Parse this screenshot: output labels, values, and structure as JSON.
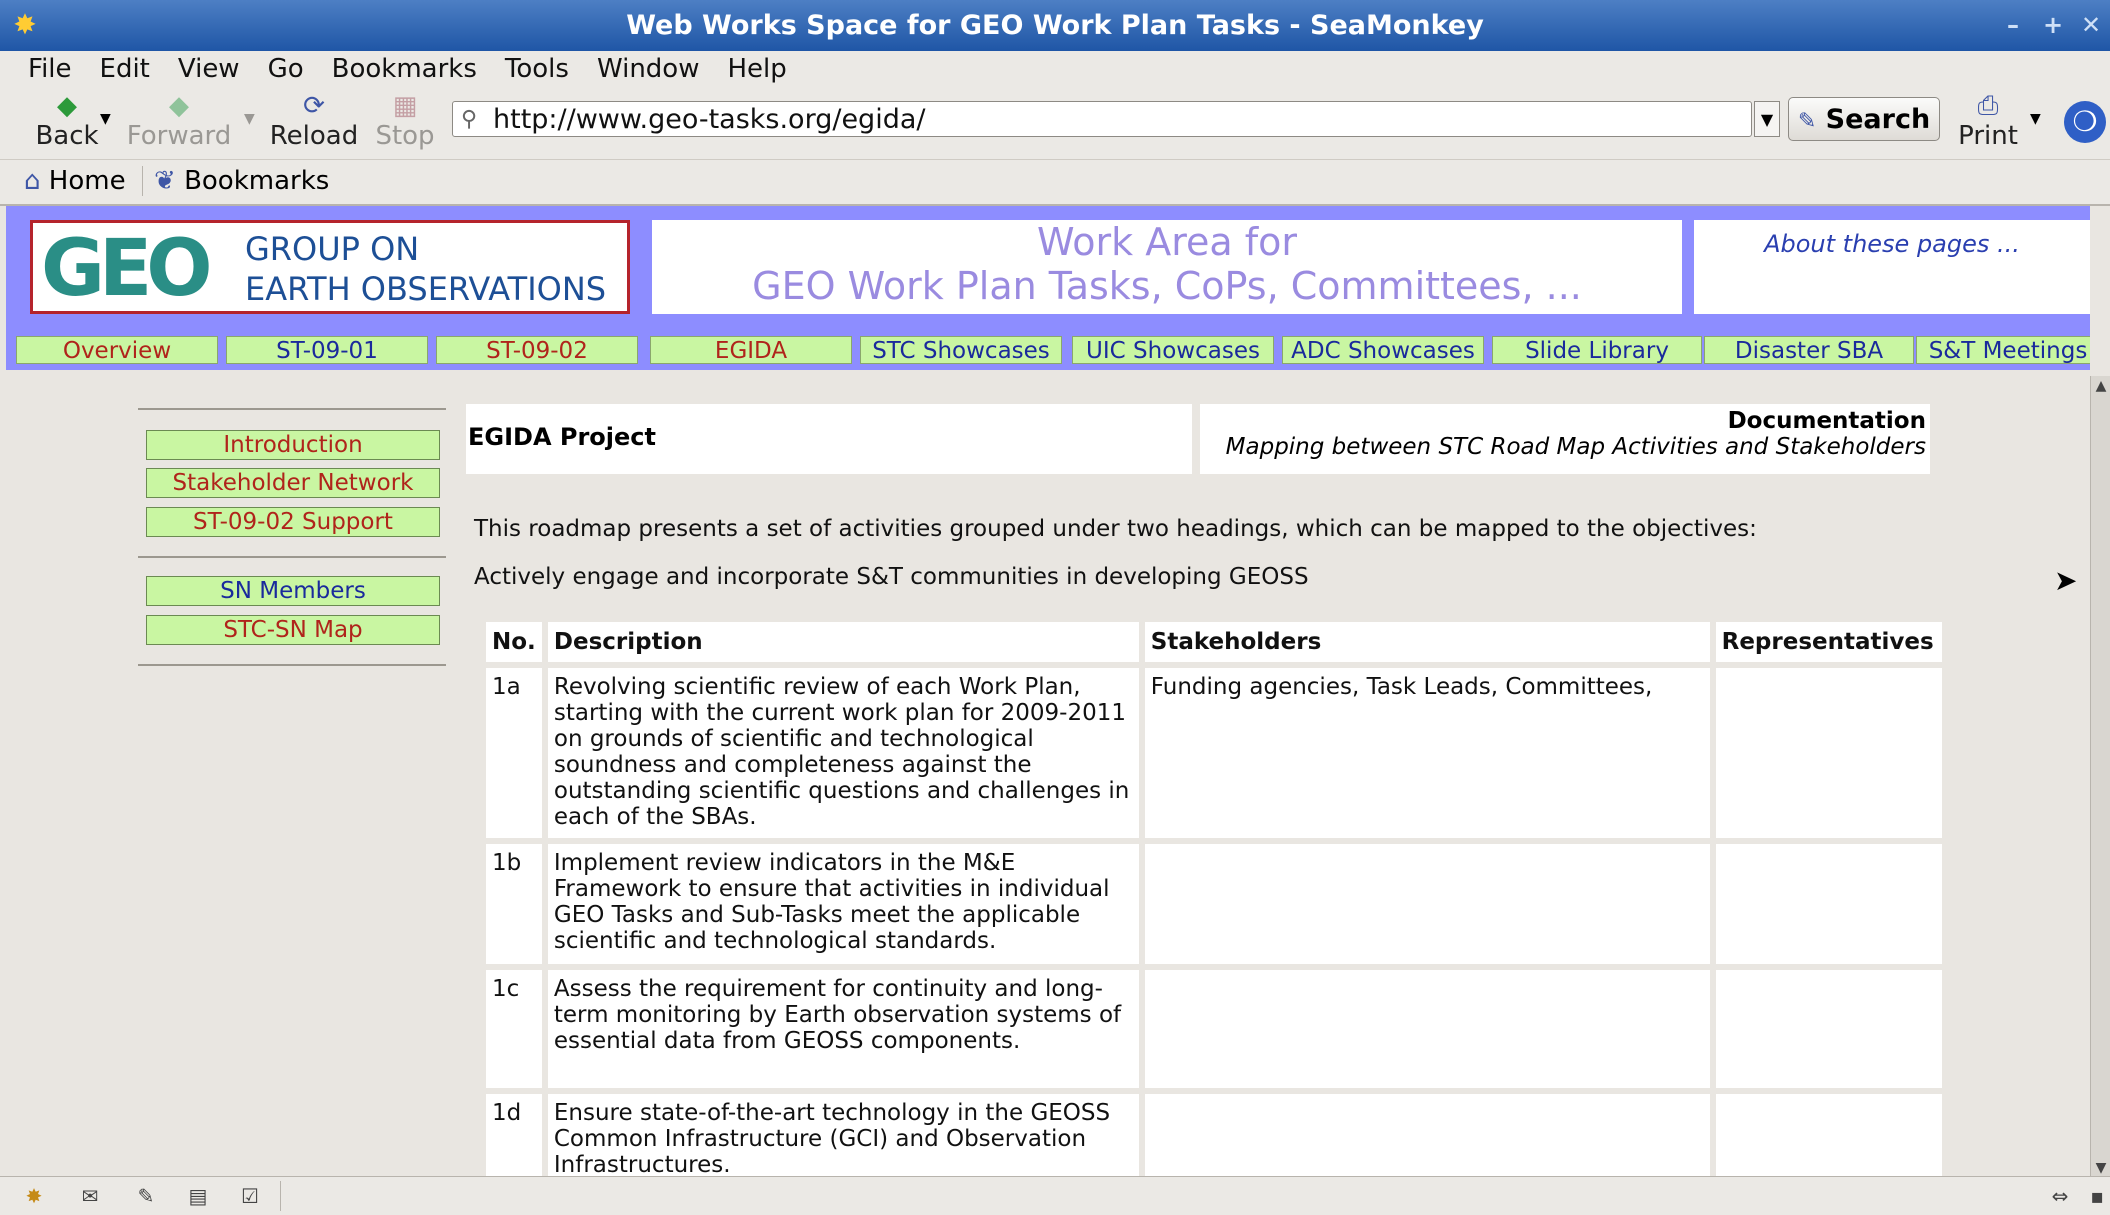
{
  "window": {
    "title": "Web Works Space for GEO Work Plan Tasks - SeaMonkey"
  },
  "menubar": [
    "File",
    "Edit",
    "View",
    "Go",
    "Bookmarks",
    "Tools",
    "Window",
    "Help"
  ],
  "toolbar": {
    "back": "Back",
    "forward": "Forward",
    "reload": "Reload",
    "stop": "Stop",
    "url": "http://www.geo-tasks.org/egida/",
    "search": "Search",
    "print": "Print"
  },
  "bookmarks_bar": {
    "home": "Home",
    "bookmarks": "Bookmarks"
  },
  "header": {
    "logo_mark": "GEO",
    "logo_line1": "GROUP ON",
    "logo_line2": "EARTH OBSERVATIONS",
    "work_line1": "Work Area for",
    "work_line2": "GEO Work Plan Tasks, CoPs, Committees, ...",
    "about": "About these pages ..."
  },
  "tabs": [
    "Overview",
    "ST-09-01",
    "ST-09-02",
    "EGIDA",
    "STC Showcases",
    "UIC Showcases",
    "ADC Showcases",
    "Slide Library",
    "Disaster SBA",
    "S&T Meetings"
  ],
  "sidebar": {
    "group1": [
      "Introduction",
      "Stakeholder Network",
      "ST-09-02 Support"
    ],
    "group2": [
      "SN Members",
      "STC-SN Map"
    ]
  },
  "page": {
    "project": "EGIDA Project",
    "doc_title": "Documentation",
    "doc_subtitle": "Mapping between STC Road Map Activities and Stakeholders",
    "intro": "This roadmap presents a set of activities grouped under two headings, which can be mapped to the objectives:",
    "heading1": "Actively engage and incorporate S&T communities in developing GEOSS"
  },
  "table": {
    "headers": [
      "No.",
      "Description",
      "Stakeholders",
      "Representatives"
    ],
    "rows": [
      {
        "no": "1a",
        "desc": "Revolving scientific review of each Work Plan, starting with the current work plan for 2009-2011 on grounds of scientific and technological soundness and completeness against the outstanding scientific questions and challenges in each of the SBAs.",
        "stake": "Funding agencies, Task Leads, Committees,",
        "rep": ""
      },
      {
        "no": "1b",
        "desc": "Implement review indicators in the M&E Framework to ensure that activities in individual GEO Tasks and Sub-Tasks meet the applicable scientific and technological standards.",
        "stake": "",
        "rep": ""
      },
      {
        "no": "1c",
        "desc": "Assess the requirement for continuity and long-term monitoring by Earth observation systems of essential data from GEOSS components.",
        "stake": "",
        "rep": ""
      },
      {
        "no": "1d",
        "desc": "Ensure state-of-the-art technology in the GEOSS Common Infrastructure (GCI) and Observation Infrastructures.",
        "stake": "",
        "rep": ""
      }
    ]
  }
}
